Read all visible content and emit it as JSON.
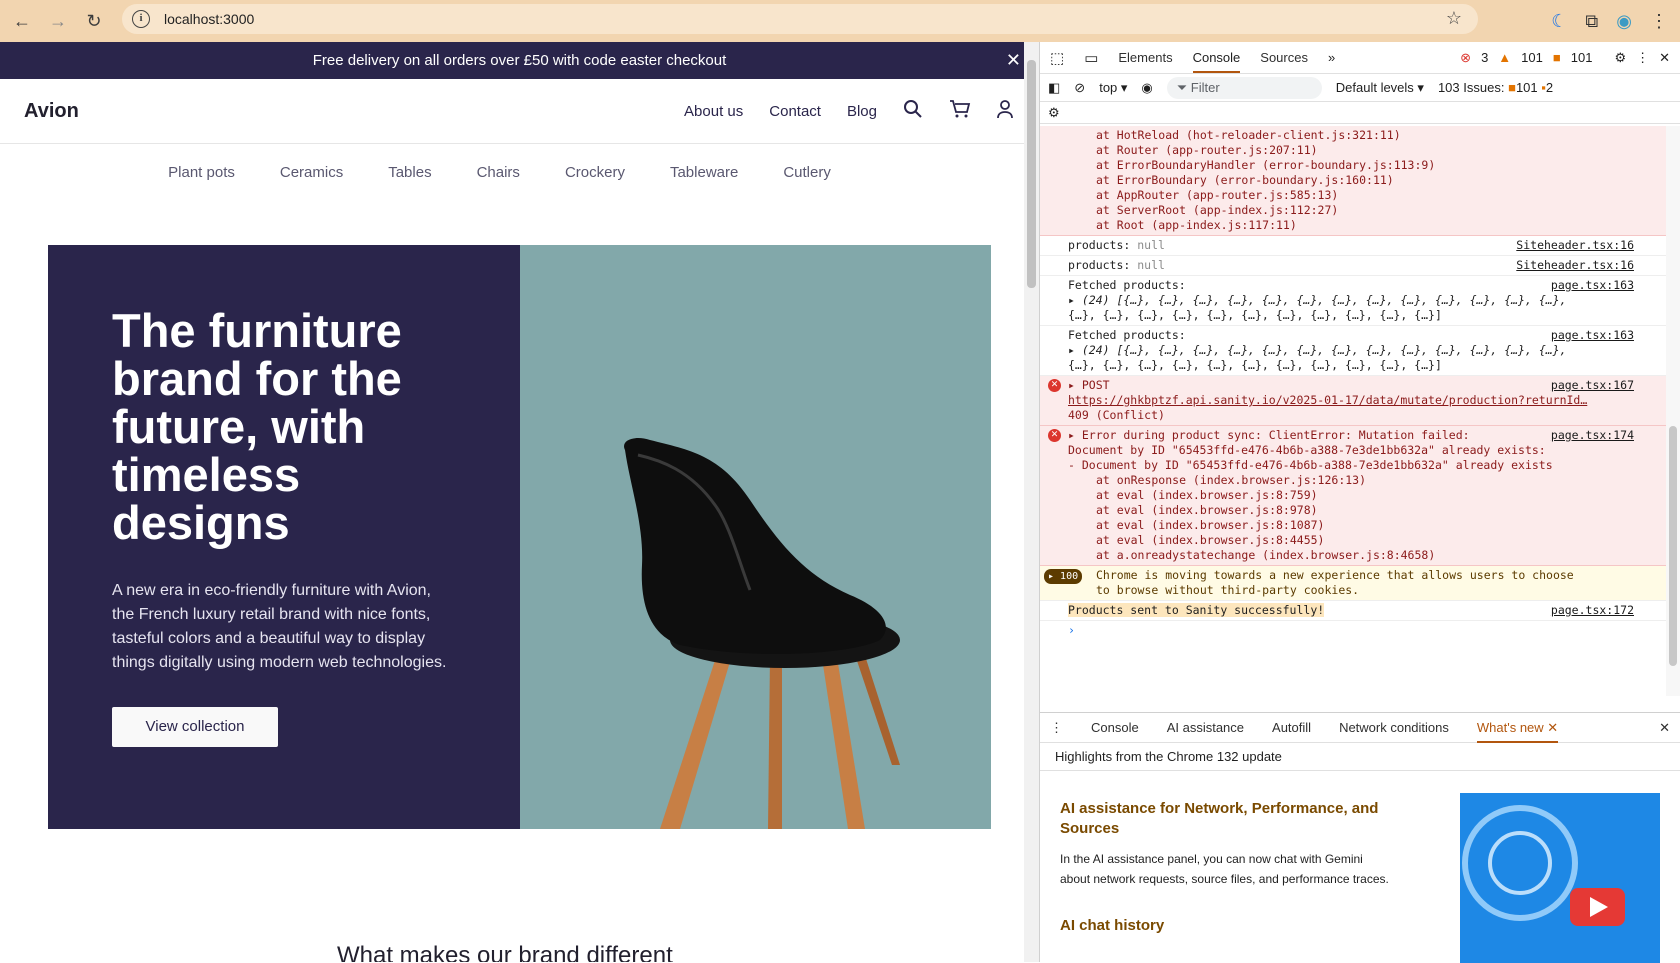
{
  "browser": {
    "url": "localhost:3000"
  },
  "site": {
    "banner_text": "Free delivery on all orders over £50 with code easter checkout",
    "logo": "Avion",
    "nav_links": [
      "About us",
      "Contact",
      "Blog"
    ],
    "categories": [
      "Plant pots",
      "Ceramics",
      "Tables",
      "Chairs",
      "Crockery",
      "Tableware",
      "Cutlery"
    ],
    "hero": {
      "heading": "The furniture brand for the future, with timeless designs",
      "body": "A new era in eco-friendly furniture with Avion, the French luxury retail brand with nice fonts, tasteful colors and a beautiful way to display things digitally using modern web technologies.",
      "cta": "View collection"
    },
    "section_title": "What makes our brand different"
  },
  "devtools": {
    "tabs": [
      "Elements",
      "Console",
      "Sources"
    ],
    "error_count": "3",
    "warning_count": "101",
    "info_count": "101",
    "context": "top",
    "filter_placeholder": "Filter",
    "levels": "Default levels",
    "issues_label": "103 Issues:",
    "issues_warn": "101",
    "issues_info": "2",
    "console": {
      "stack1": [
        "at HotReload (hot-reloader-client.js:321:11)",
        "at Router (app-router.js:207:11)",
        "at ErrorBoundaryHandler (error-boundary.js:113:9)",
        "at ErrorBoundary (error-boundary.js:160:11)",
        "at AppRouter (app-router.js:585:13)",
        "at ServerRoot (app-index.js:112:27)",
        "at Root (app-index.js:117:11)"
      ],
      "log1": {
        "label": "products:",
        "value": "null",
        "src": "Siteheader.tsx:16"
      },
      "log2": {
        "label": "products:",
        "value": "null",
        "src": "Siteheader.tsx:16"
      },
      "fetched1": {
        "label": "Fetched products:",
        "src": "page.tsx:163",
        "line1": "(24) [{…}, {…}, {…}, {…}, {…}, {…}, {…}, {…}, {…}, {…}, {…}, {…}, {…},",
        "line2": "{…}, {…}, {…}, {…}, {…}, {…}, {…}, {…}, {…}, {…}, {…}]"
      },
      "fetched2": {
        "label": "Fetched products:",
        "src": "page.tsx:163",
        "line1": "(24) [{…}, {…}, {…}, {…}, {…}, {…}, {…}, {…}, {…}, {…}, {…}, {…}, {…},",
        "line2": "{…}, {…}, {…}, {…}, {…}, {…}, {…}, {…}, {…}, {…}, {…}]"
      },
      "post": {
        "label": "POST",
        "src": "page.tsx:167",
        "url": "https://ghkbptzf.api.sanity.io/v2025-01-17/data/mutate/production?returnId…",
        "status": "409 (Conflict)"
      },
      "error2": {
        "line1": "Error during product sync: ClientError: Mutation failed:",
        "src": "page.tsx:174",
        "line2": "Document by ID \"65453ffd-e476-4b6b-a388-7e3de1bb632a\" already exists:",
        "line3": "- Document by ID \"65453ffd-e476-4b6b-a388-7e3de1bb632a\" already exists",
        "stack": [
          "at onResponse (index.browser.js:126:13)",
          "at eval (index.browser.js:8:759)",
          "at eval (index.browser.js:8:978)",
          "at eval (index.browser.js:8:1087)",
          "at eval (index.browser.js:8:4455)",
          "at a.onreadystatechange (index.browser.js:8:4658)"
        ]
      },
      "cookie": {
        "count": "100",
        "line1": "Chrome is moving towards a new experience that allows users to choose",
        "line2": "to browse without third-party cookies."
      },
      "success": {
        "text": "Products sent to Sanity successfully!",
        "src": "page.tsx:172"
      }
    },
    "drawer": {
      "tabs": [
        "Console",
        "AI assistance",
        "Autofill",
        "Network conditions",
        "What's new"
      ],
      "subheader": "Highlights from the Chrome 132 update",
      "title1": "AI assistance for Network, Performance, and Sources",
      "body1": "In the AI assistance panel, you can now chat with Gemini about network requests, source files, and performance traces.",
      "title2": "AI chat history"
    }
  },
  "colors": {
    "brand_dark": "#2a254b",
    "hero_right": "#82a8aa",
    "chrome_bar": "#f2d5b0",
    "error_bg": "#fcebeb"
  }
}
